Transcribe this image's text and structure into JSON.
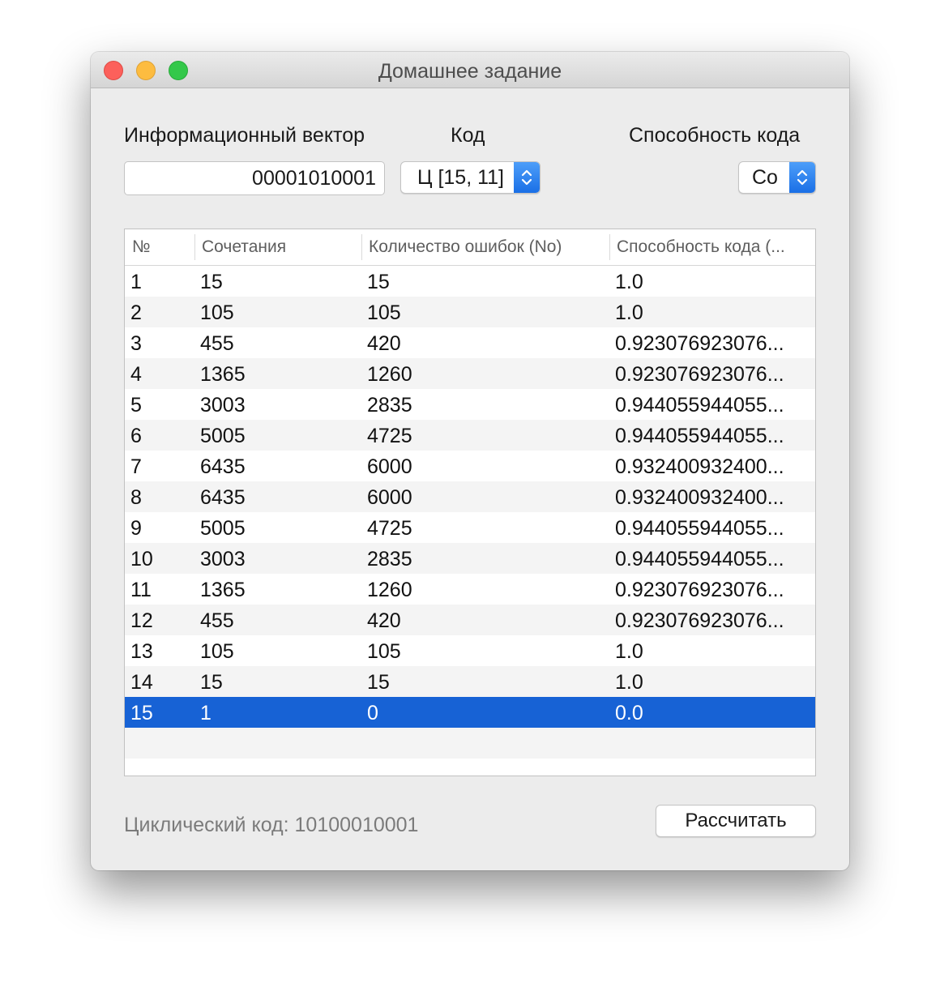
{
  "window": {
    "title": "Домашнее задание"
  },
  "form": {
    "vector_label": "Информационный вектор",
    "vector_value": "00001010001",
    "code_label": "Код",
    "code_value": "Ц [15, 11]",
    "ability_label": "Способность кода",
    "ability_value": "Co"
  },
  "table": {
    "columns": [
      "№",
      "Сочетания",
      "Количество ошибок (No)",
      "Способность кода (..."
    ],
    "rows": [
      [
        "1",
        "15",
        "15",
        "1.0"
      ],
      [
        "2",
        "105",
        "105",
        "1.0"
      ],
      [
        "3",
        "455",
        "420",
        "0.923076923076..."
      ],
      [
        "4",
        "1365",
        "1260",
        "0.923076923076..."
      ],
      [
        "5",
        "3003",
        "2835",
        "0.944055944055..."
      ],
      [
        "6",
        "5005",
        "4725",
        "0.944055944055..."
      ],
      [
        "7",
        "6435",
        "6000",
        "0.932400932400..."
      ],
      [
        "8",
        "6435",
        "6000",
        "0.932400932400..."
      ],
      [
        "9",
        "5005",
        "4725",
        "0.944055944055..."
      ],
      [
        "10",
        "3003",
        "2835",
        "0.944055944055..."
      ],
      [
        "11",
        "1365",
        "1260",
        "0.923076923076..."
      ],
      [
        "12",
        "455",
        "420",
        "0.923076923076..."
      ],
      [
        "13",
        "105",
        "105",
        "1.0"
      ],
      [
        "14",
        "15",
        "15",
        "1.0"
      ],
      [
        "15",
        "1",
        "0",
        "0.0"
      ]
    ],
    "selected_row": 15
  },
  "footer": {
    "cyclic_code": "Циклический код: 10100010001",
    "calculate_label": "Рассчитать"
  },
  "icons": {
    "close": "close-icon",
    "minimize": "minimize-icon",
    "maximize": "maximize-icon",
    "stepper": "up-down-chevron-icon"
  },
  "colors": {
    "selection": "#1762d5",
    "accent": "#1a6fe6",
    "close": "#fc605b",
    "minimize": "#fdbc40",
    "maximize": "#34c84a"
  }
}
